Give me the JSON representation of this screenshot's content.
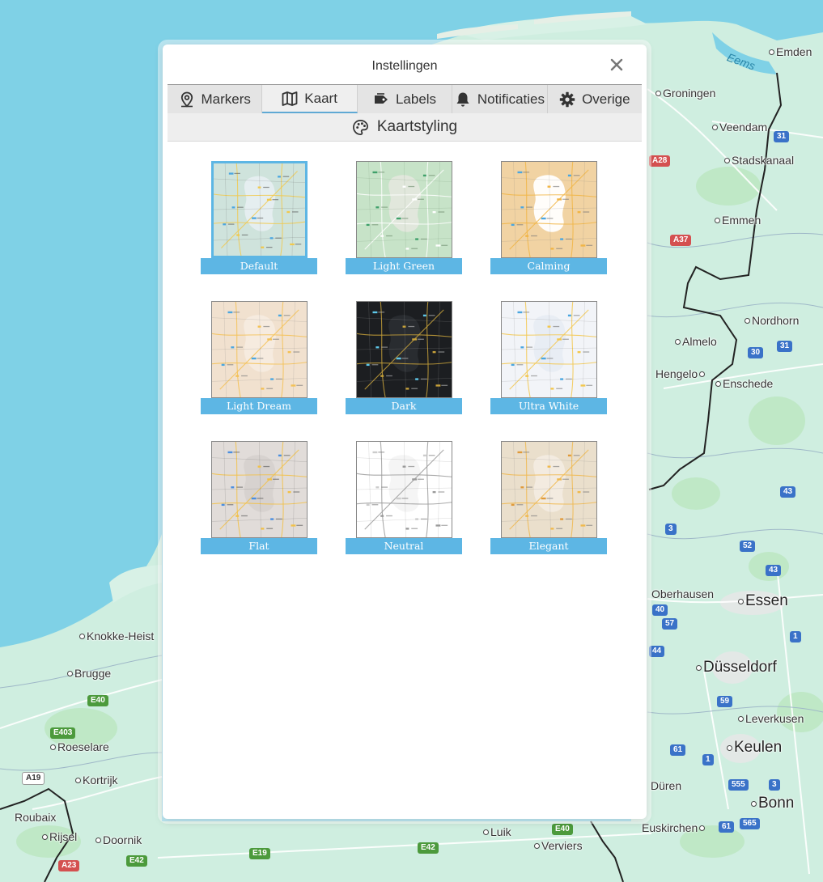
{
  "modal": {
    "title": "Instellingen",
    "close_icon": "close-icon"
  },
  "tabs": [
    {
      "label": "Markers",
      "icon": "map-pin-icon",
      "active": false
    },
    {
      "label": "Kaart",
      "icon": "map-icon",
      "active": true
    },
    {
      "label": "Labels",
      "icon": "tag-icon",
      "active": false
    },
    {
      "label": "Notificaties",
      "icon": "bell-icon",
      "active": false
    },
    {
      "label": "Overige",
      "icon": "gear-icon",
      "active": false
    }
  ],
  "section": {
    "title": "Kaartstyling",
    "icon": "palette-icon"
  },
  "styles": [
    {
      "label": "Default",
      "selected": true,
      "bg": "#cfe3dc",
      "land": "#e6eef0",
      "road": "#f1c94d",
      "accent": "#4aa6e0",
      "text": "#555555"
    },
    {
      "label": "Light Green",
      "selected": false,
      "bg": "#c7e3c8",
      "land": "#e3e7dd",
      "road": "#ffffff",
      "accent": "#3fa06a",
      "text": "#6a8b6a"
    },
    {
      "label": "Calming",
      "selected": false,
      "bg": "#f1d3a3",
      "land": "#ffffff",
      "road": "#f1b545",
      "accent": "#4aa6e0",
      "text": "#777777"
    },
    {
      "label": "Light Dream",
      "selected": false,
      "bg": "#f1e1cf",
      "land": "#f6ebdf",
      "road": "#f4c155",
      "accent": "#4aa6e0",
      "text": "#777777"
    },
    {
      "label": "Dark",
      "selected": false,
      "bg": "#1c1e21",
      "land": "#2a2d31",
      "road": "#c8a23a",
      "accent": "#5ec8ea",
      "text": "#bbbbbb"
    },
    {
      "label": "Ultra White",
      "selected": false,
      "bg": "#f2f4f8",
      "land": "#e7ecf3",
      "road": "#f3c74d",
      "accent": "#4aa6e0",
      "text": "#777777"
    },
    {
      "label": "Flat",
      "selected": false,
      "bg": "#e1dcd9",
      "land": "#d6d1cf",
      "road": "#f2c148",
      "accent": "#4a8ee0",
      "text": "#555555"
    },
    {
      "label": "Neutral",
      "selected": false,
      "bg": "#ffffff",
      "land": "#f4f4f4",
      "road": "#9a9a9a",
      "accent": "#cccccc",
      "text": "#777777"
    },
    {
      "label": "Elegant",
      "selected": false,
      "bg": "#eadfcc",
      "land": "#f3ebe0",
      "road": "#f0b94d",
      "accent": "#e09a3a",
      "text": "#777777"
    }
  ],
  "background_map": {
    "places": [
      "Emden",
      "Groningen",
      "Veendam",
      "Stadskanaal",
      "Emmen",
      "Nordhorn",
      "Almelo",
      "Hengelo",
      "Enschede",
      "Essen",
      "Düsseldorf",
      "Leverkusen",
      "Keulen",
      "Bonn",
      "Düren",
      "Euskirchen",
      "Luik",
      "Verviers",
      "Brugge",
      "Knokke-Heist",
      "Roeselare",
      "Kortrijk",
      "Roubaix",
      "Rijsel",
      "Doornik",
      "Oberhausen",
      "Eems"
    ],
    "roads": [
      "31",
      "A28",
      "A37",
      "30",
      "31",
      "43",
      "3",
      "52",
      "43",
      "40",
      "57",
      "44",
      "1",
      "59",
      "61",
      "1",
      "555",
      "3",
      "61",
      "565",
      "E40",
      "E403",
      "A19",
      "A23",
      "E42",
      "E19",
      "E42",
      "E40"
    ],
    "colors": {
      "water": "#7fd1e6",
      "land": "#cfeee0",
      "forest": "#bfe8c6",
      "border": "#222222"
    }
  }
}
